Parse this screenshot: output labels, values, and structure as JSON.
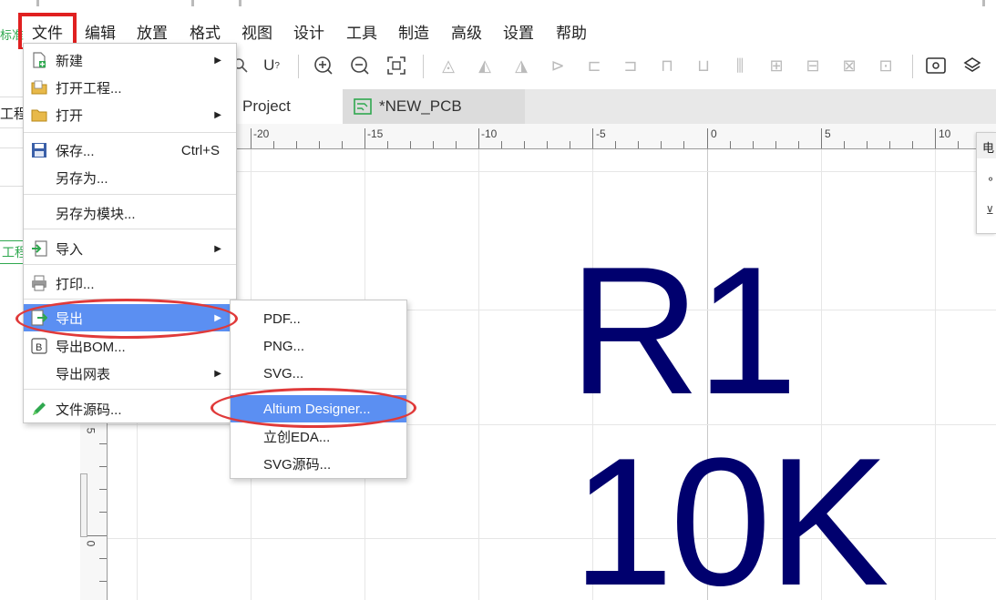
{
  "menubar": {
    "left_cut": "标准",
    "items": [
      "文件",
      "编辑",
      "放置",
      "格式",
      "视图",
      "设计",
      "工具",
      "制造",
      "高级",
      "设置",
      "帮助"
    ]
  },
  "left_panel": {
    "label_project": "工程",
    "label_project_tag": "工程"
  },
  "tabs": [
    {
      "label": "Project",
      "state": "active"
    },
    {
      "label": "*NEW_PCB",
      "state": "inactive"
    }
  ],
  "ruler": {
    "top_labels": [
      "-20",
      "-15",
      "-10",
      "-5",
      "0",
      "5",
      "10"
    ],
    "left_labels": [
      "5",
      "0"
    ]
  },
  "canvas_text": {
    "line1": "R1",
    "line2": "10K",
    "color": "#00006e"
  },
  "right_panel": {
    "header": "电"
  },
  "file_menu": {
    "items": [
      {
        "label": "新建",
        "icon": "new-file-icon",
        "submenu": true
      },
      {
        "label": "打开工程...",
        "icon": "open-project-icon"
      },
      {
        "label": "打开",
        "icon": "folder-icon",
        "submenu": true
      },
      {
        "label": "保存...",
        "icon": "save-icon",
        "shortcut": "Ctrl+S"
      },
      {
        "label": "另存为..."
      },
      {
        "label": "另存为模块..."
      },
      {
        "label": "导入",
        "icon": "import-icon",
        "submenu": true
      },
      {
        "label": "打印...",
        "icon": "printer-icon"
      },
      {
        "label": "导出",
        "icon": "export-icon",
        "submenu": true,
        "selected": true
      },
      {
        "label": "导出BOM...",
        "icon": "bom-icon"
      },
      {
        "label": "导出网表",
        "submenu": true
      },
      {
        "label": "文件源码...",
        "icon": "pencil-icon"
      }
    ]
  },
  "export_submenu": {
    "items": [
      {
        "label": "PDF..."
      },
      {
        "label": "PNG..."
      },
      {
        "label": "SVG..."
      },
      {
        "label": "Altium Designer...",
        "selected": true
      },
      {
        "label": "立创EDA..."
      },
      {
        "label": "SVG源码..."
      }
    ]
  },
  "colors": {
    "accent_selected": "#5b8ff2",
    "annotation_red": "#e02020",
    "brand_green": "#2fa84f"
  }
}
